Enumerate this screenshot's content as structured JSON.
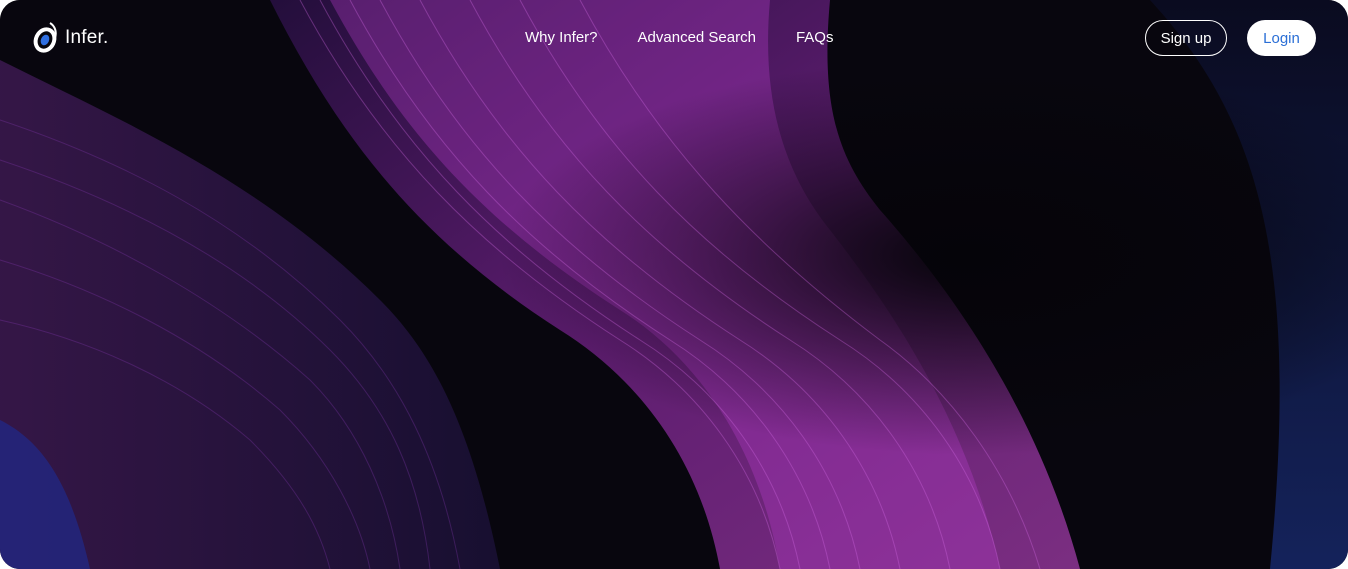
{
  "brand": {
    "name": "Infer.",
    "logo_icon": "infer-logo-icon"
  },
  "nav": {
    "links": [
      {
        "label": "Why Infer?"
      },
      {
        "label": "Advanced Search"
      },
      {
        "label": "FAQs"
      }
    ]
  },
  "auth": {
    "signup_label": "Sign up",
    "login_label": "Login"
  },
  "colors": {
    "background": "#07060c",
    "accent_magenta": "#c23ad1",
    "accent_purple": "#5b2a9e",
    "accent_blue": "#2a3aa8",
    "login_text": "#2b6fd6"
  }
}
